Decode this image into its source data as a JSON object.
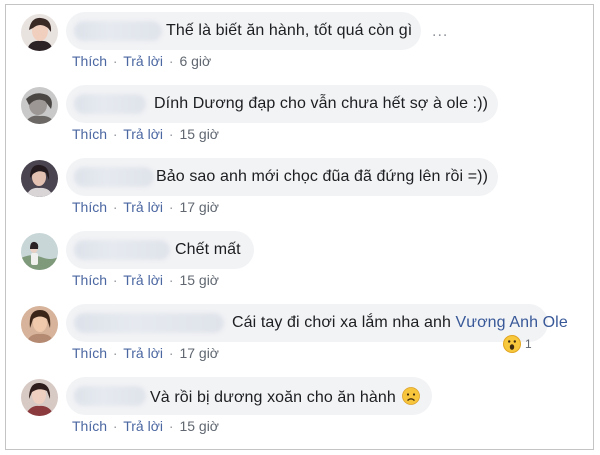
{
  "actions": {
    "like": "Thích",
    "reply": "Trả lời",
    "separator": "·"
  },
  "comments": [
    {
      "text": "Thế là biết ăn hành, tốt quá còn gì",
      "time": "6 giờ"
    },
    {
      "text": "Dính Dương đạp cho vẫn chưa hết sợ à ole :))",
      "time": "15 giờ"
    },
    {
      "text": "Bảo sao anh mới chọc đũa đã đứng lên rồi =))",
      "time": "17 giờ"
    },
    {
      "text": "Chết mất",
      "time": "15 giờ"
    },
    {
      "text": "Cái tay đi chơi xa lắm nha anh",
      "mention": "Vương Anh Ole",
      "time": "17 giờ",
      "reaction": {
        "icon": "wow-emoji-icon",
        "count": "1"
      }
    },
    {
      "text": "Và rồi bị dương xoăn cho ăn hành",
      "emoji": "sad-face-emoji-icon",
      "time": "15 giờ"
    }
  ],
  "more_options": "...",
  "colors": {
    "bubble_bg": "#f2f3f5",
    "link": "#4b67a1",
    "mention": "#385898",
    "meta": "#606770",
    "text": "#1c1e21"
  }
}
